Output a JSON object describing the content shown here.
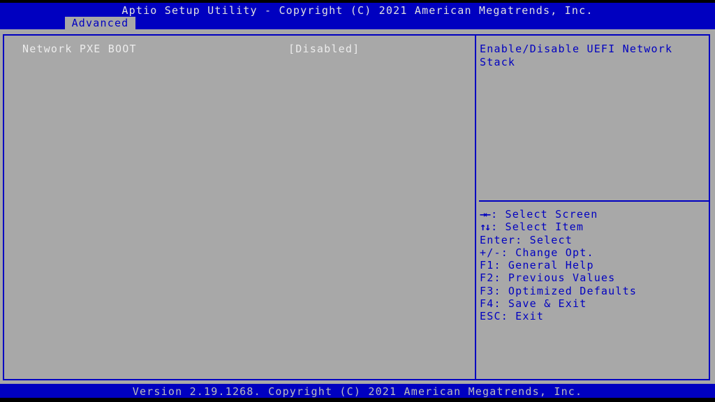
{
  "header": {
    "title": "Aptio Setup Utility - Copyright (C) 2021 American Megatrends, Inc.",
    "tabs": [
      {
        "label": "Advanced",
        "active": true
      }
    ]
  },
  "settings": [
    {
      "label": "Network PXE BOOT",
      "value": "[Disabled]"
    }
  ],
  "help": {
    "description": "Enable/Disable UEFI Network Stack"
  },
  "keys": [
    {
      "icon": "left-right-arrows-icon",
      "glyph": "→←",
      "text": ": Select Screen"
    },
    {
      "icon": "up-down-arrows-icon",
      "glyph": "↑↓",
      "text": ": Select Item"
    },
    {
      "text": "Enter: Select"
    },
    {
      "text": "+/-: Change Opt."
    },
    {
      "text": "F1: General Help"
    },
    {
      "text": "F2: Previous Values"
    },
    {
      "text": "F3: Optimized Defaults"
    },
    {
      "text": "F4: Save & Exit"
    },
    {
      "text": "ESC: Exit"
    }
  ],
  "footer": {
    "text": "Version 2.19.1268. Copyright (C) 2021 American Megatrends, Inc."
  },
  "colors": {
    "bar_blue": "#0000c0",
    "panel_gray": "#a8a8a8",
    "item_text": "#ececec",
    "help_text": "#0000c0"
  }
}
